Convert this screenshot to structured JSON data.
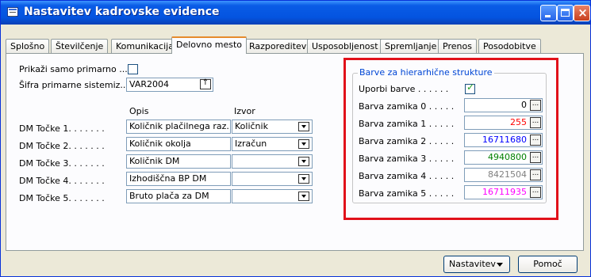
{
  "window": {
    "title": "Nastavitev kadrovske evidence",
    "controls": {
      "minimize": "",
      "maximize": "",
      "close": "×"
    }
  },
  "tabs": [
    {
      "label": "Splošno"
    },
    {
      "label": "Številčenje"
    },
    {
      "label": "Komunikacija"
    },
    {
      "label": "Delovno mesto",
      "active": true
    },
    {
      "label": "Razporeditev"
    },
    {
      "label": "Usposobljenost"
    },
    {
      "label": "Spremljanje"
    },
    {
      "label": "Prenos"
    },
    {
      "label": "Posodobitve"
    }
  ],
  "left": {
    "show_primary_label": "Prikaži samo primarno ...",
    "show_primary_checked": false,
    "system_code_label": "Šifra primarne sistemiz...",
    "system_code_value": "VAR2004",
    "col_description": "Opis",
    "col_source": "Izvor",
    "dm_rows": [
      {
        "label": "DM Točke 1. . . . . . .",
        "description": "Količnik plačilnega raz...",
        "source": "Količnik"
      },
      {
        "label": "DM Točke 2. . . . . . .",
        "description": "Količnik okolja",
        "source": "Izračun"
      },
      {
        "label": "DM Točke 3. . . . . . .",
        "description": "Količnik DM",
        "source": ""
      },
      {
        "label": "DM Točke 4. . . . . . .",
        "description": "Izhodiščna BP DM",
        "source": ""
      },
      {
        "label": "DM Točke 5. . . . . . .",
        "description": "Bruto plača za DM",
        "source": ""
      }
    ]
  },
  "colors_group": {
    "title": "Barve za hierarhične strukture",
    "use_colors_label": "Uporbi barve . . . . . .",
    "use_colors_checked": true,
    "levels": [
      {
        "label": "Barva zamika 0 . . . . .",
        "value": "0",
        "color": "#000000"
      },
      {
        "label": "Barva zamika 1 . . . . .",
        "value": "255",
        "color": "#ff0000"
      },
      {
        "label": "Barva zamika 2 . . . . .",
        "value": "16711680",
        "color": "#0000ff"
      },
      {
        "label": "Barva zamika 3 . . . . .",
        "value": "4940800",
        "color": "#008000"
      },
      {
        "label": "Barva zamika 4 . . . . .",
        "value": "8421504",
        "color": "#808080"
      },
      {
        "label": "Barva zamika 5 . . . . .",
        "value": "16711935",
        "color": "#ff00ff"
      }
    ],
    "lookup_glyph": "..."
  },
  "footer": {
    "settings_button": "Nastavitev",
    "help_button": "Pomoč"
  }
}
